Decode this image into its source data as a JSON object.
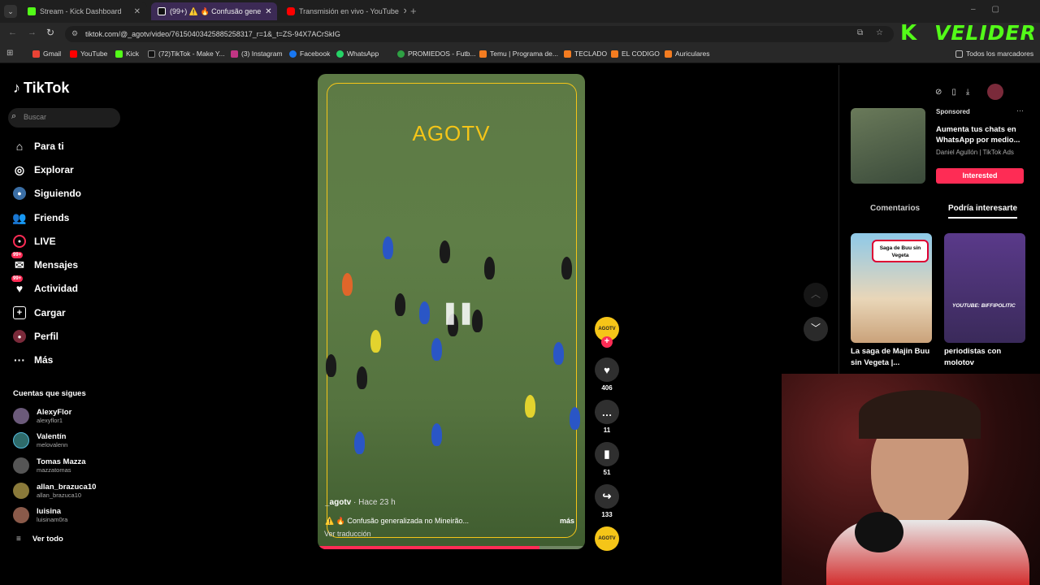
{
  "browser": {
    "tabs": [
      {
        "label": "Stream - Kick Dashboard",
        "color": "#53fc18"
      },
      {
        "label": "(99+) ⚠️ 🔥 Confusão gene",
        "color": "#ffffff"
      },
      {
        "label": "Transmisión en vivo - YouTube",
        "color": "#ff0000"
      }
    ],
    "url": "tiktok.com/@_agotv/video/7615040342588525831​7_r=1&_t=ZS-94X7ACrSkIG",
    "bookmarks": [
      "Gmail",
      "YouTube",
      "Kick",
      "(72)TikTok - Make Y...",
      "(3) Instagram",
      "Facebook",
      "WhatsApp",
      "PROMIEDOS - Futb...",
      "Temu | Programa de...",
      "TECLADO",
      "EL CODIGO",
      "Auriculares"
    ],
    "all_bookmarks": "Todos los marcadores",
    "overlay_logo": "VELIDER",
    "overlay_k": "K"
  },
  "sidebar": {
    "logo": "TikTok",
    "search_placeholder": "Buscar",
    "nav": [
      {
        "label": "Para ti",
        "icon": "home-icon"
      },
      {
        "label": "Explorar",
        "icon": "compass-icon"
      },
      {
        "label": "Siguiendo",
        "icon": "following-icon"
      },
      {
        "label": "Friends",
        "icon": "friends-icon"
      },
      {
        "label": "LIVE",
        "icon": "live-icon"
      },
      {
        "label": "Mensajes",
        "icon": "messages-icon",
        "badge": "99+"
      },
      {
        "label": "Actividad",
        "icon": "activity-icon",
        "badge": "99+"
      },
      {
        "label": "Cargar",
        "icon": "upload-icon"
      },
      {
        "label": "Perfil",
        "icon": "profile-icon"
      },
      {
        "label": "Más",
        "icon": "more-icon"
      }
    ],
    "following_title": "Cuentas que sigues",
    "following": [
      {
        "name": "AlexyFlor",
        "user": "alexyflor1"
      },
      {
        "name": "Valentín",
        "user": "melovalenn"
      },
      {
        "name": "Tomas Mazza",
        "user": "mazzatomas"
      },
      {
        "name": "allan_brazuca10",
        "user": "allan_brazuca10"
      },
      {
        "name": "luisina",
        "user": "luisinam0ra"
      }
    ],
    "see_all": "Ver todo"
  },
  "video": {
    "watermark": "AGOTV",
    "author": "_agotv",
    "time": "· Hace 23 h",
    "caption": "⚠️ 🔥 Confusão generalizada no Mineirão...",
    "more": "más",
    "translate": "Ver traducción",
    "progress": 0.83,
    "likes": "406",
    "comments": "11",
    "saves": "51",
    "shares": "133",
    "avatar_text": "AGOTV"
  },
  "right": {
    "sponsored": "Sponsored",
    "ad_title": "Aumenta tus chats en WhatsApp por medio...",
    "ad_source": "Daniel Agullón | TikTok Ads",
    "ad_button": "Interested",
    "tabs": [
      "Comentarios",
      "Podría interesarte"
    ],
    "cards": [
      {
        "title": "La saga de Majin Buu sin Vegeta |...",
        "badge": "Saga de Buu sin Vegeta"
      },
      {
        "title": "periodistas con molotov",
        "badge": "YOUTUBE: BIFFIPOLITIC"
      }
    ]
  },
  "colors": {
    "accent": "#fe2c55",
    "chrome": "#282828",
    "video_border": "#f5c518"
  }
}
